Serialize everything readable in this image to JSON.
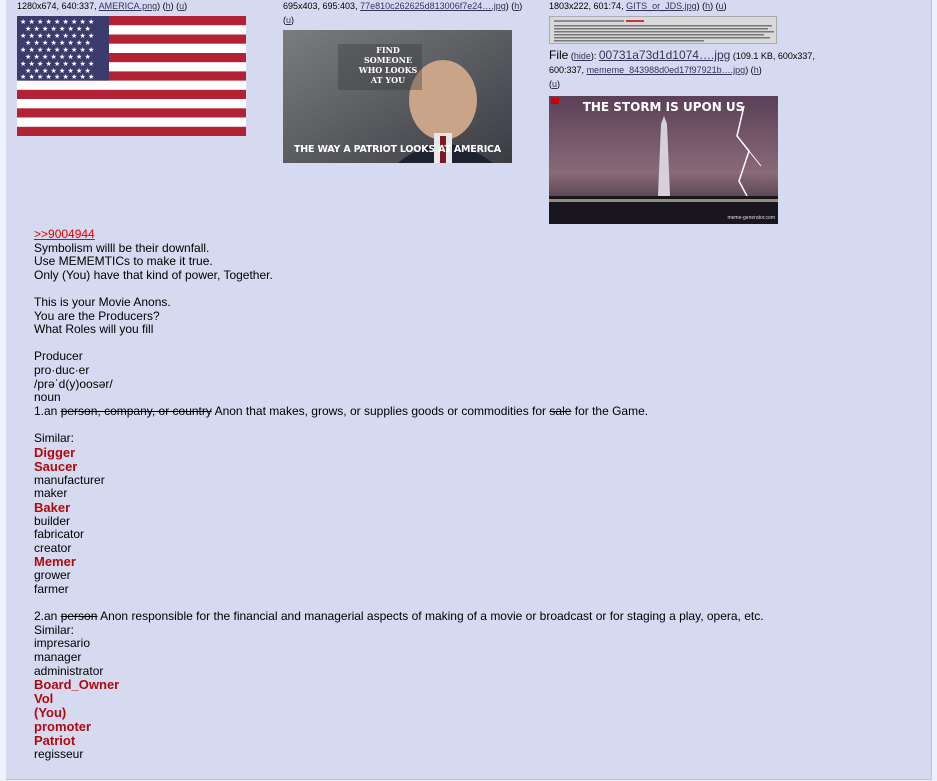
{
  "files": [
    {
      "dims": "1280x674, 640:337,",
      "name": "AMERICA.png",
      "h": "h",
      "u": "u"
    },
    {
      "dims": "695x403, 695:403,",
      "name": "77e810c262625d813006f7e24….jpg",
      "h": "h",
      "u": "u",
      "img_text_top": "FIND SOMEONE WHO LOOKS AT YOU",
      "img_text_bottom": "THE WAY A PATRIOT LOOKS AT AMERICA"
    },
    {
      "dims": "1803x222, 601:74,",
      "name": "GITS_or_JDS.jpg",
      "h": "h",
      "u": "u"
    },
    {
      "label": "File",
      "hide": "hide",
      "name": "00731a73d1d1074….jpg",
      "size": "(109.1 KB,",
      "dims": "600x337, 600:337,",
      "orig": "mememe_843988d0ed17f97921b….jpg",
      "h": "h",
      "u": "u",
      "img_text": "THE STORM IS UPON US",
      "corner": "meme-generator.com"
    }
  ],
  "post": {
    "quotelink": ">>9004944",
    "lines1": [
      "Symbolism willl be their downfall.",
      "Use MEMEMTICs to make it true.",
      "Only (You) have that kind of power, Together."
    ],
    "lines2": [
      "This is your Movie Anons.",
      "You are the Producers?",
      "What Roles will you fill"
    ],
    "def_word": "Producer",
    "syllables": "pro·duc·er",
    "pron": "/prəˈd(y)oosər/",
    "pos": "noun",
    "def1_prefix": "1.an ",
    "def1_struck": "person, company, or country",
    "def1_mid": " Anon that makes, grows, or supplies goods or commodities for ",
    "def1_struck2": "sale",
    "def1_end": " for the Game.",
    "similar": "Similar:",
    "list1": [
      {
        "t": "Digger",
        "red": true
      },
      {
        "t": "Saucer",
        "red": true
      },
      {
        "t": "manufacturer",
        "red": false
      },
      {
        "t": "maker",
        "red": false
      },
      {
        "t": "Baker",
        "red": true
      },
      {
        "t": "builder",
        "red": false
      },
      {
        "t": "fabricator",
        "red": false
      },
      {
        "t": "creator",
        "red": false
      },
      {
        "t": "Memer",
        "red": true
      },
      {
        "t": "grower",
        "red": false
      },
      {
        "t": "farmer",
        "red": false
      }
    ],
    "def2_prefix": "2.an ",
    "def2_struck": "person",
    "def2_rest": " Anon responsible for the financial and managerial aspects of making of a movie or broadcast or for staging a play, opera, etc.",
    "similar2": "Similar:",
    "list2": [
      {
        "t": "impresario",
        "red": false
      },
      {
        "t": "manager",
        "red": false
      },
      {
        "t": "administrator",
        "red": false
      },
      {
        "t": "Board_Owner",
        "red": true
      },
      {
        "t": "Vol",
        "red": true
      },
      {
        "t": "(You)",
        "red": true
      },
      {
        "t": "promoter",
        "red": true
      },
      {
        "t": "Patriot",
        "red": true
      },
      {
        "t": "regisseur",
        "red": false
      }
    ]
  }
}
